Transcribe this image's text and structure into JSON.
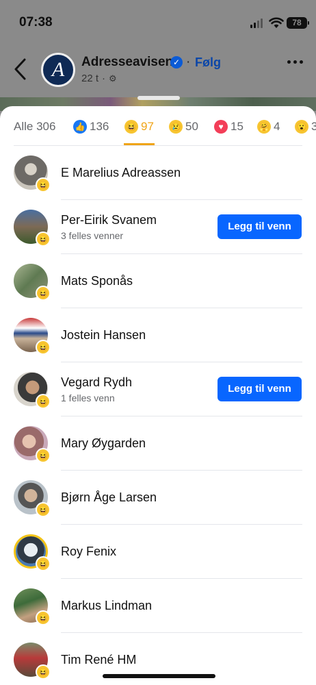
{
  "status": {
    "time": "07:38",
    "battery": "78"
  },
  "header": {
    "page_name": "Adresseavisen",
    "follow_label": "Følg",
    "age": "22 t",
    "logo_letter": "A"
  },
  "tabs": [
    {
      "label": "Alle 306",
      "active": false
    },
    {
      "icon": "like-reaction-icon",
      "count": "136",
      "active": false
    },
    {
      "icon": "haha-reaction-icon",
      "count": "97",
      "active": true
    },
    {
      "icon": "sad-reaction-icon",
      "count": "50",
      "active": false
    },
    {
      "icon": "love-reaction-icon",
      "count": "15",
      "active": false
    },
    {
      "icon": "care-reaction-icon",
      "count": "4",
      "active": false
    },
    {
      "icon": "wow-reaction-icon",
      "count": "3",
      "active": false
    }
  ],
  "people": [
    {
      "name": "E Marelius Adreassen"
    },
    {
      "name": "Per-Eirik Svanem",
      "mutual": "3 felles venner",
      "action": "Legg til venn"
    },
    {
      "name": "Mats Sponås"
    },
    {
      "name": "Jostein Hansen"
    },
    {
      "name": "Vegard Rydh",
      "mutual": "1 felles venn",
      "action": "Legg til venn"
    },
    {
      "name": "Mary Øygarden"
    },
    {
      "name": "Bjørn Åge Larsen"
    },
    {
      "name": "Roy Fenix"
    },
    {
      "name": "Markus Lindman"
    },
    {
      "name": "Tim René HM"
    }
  ],
  "colors": {
    "accent_blue": "#0866ff",
    "haha_yellow": "#f0a416"
  }
}
